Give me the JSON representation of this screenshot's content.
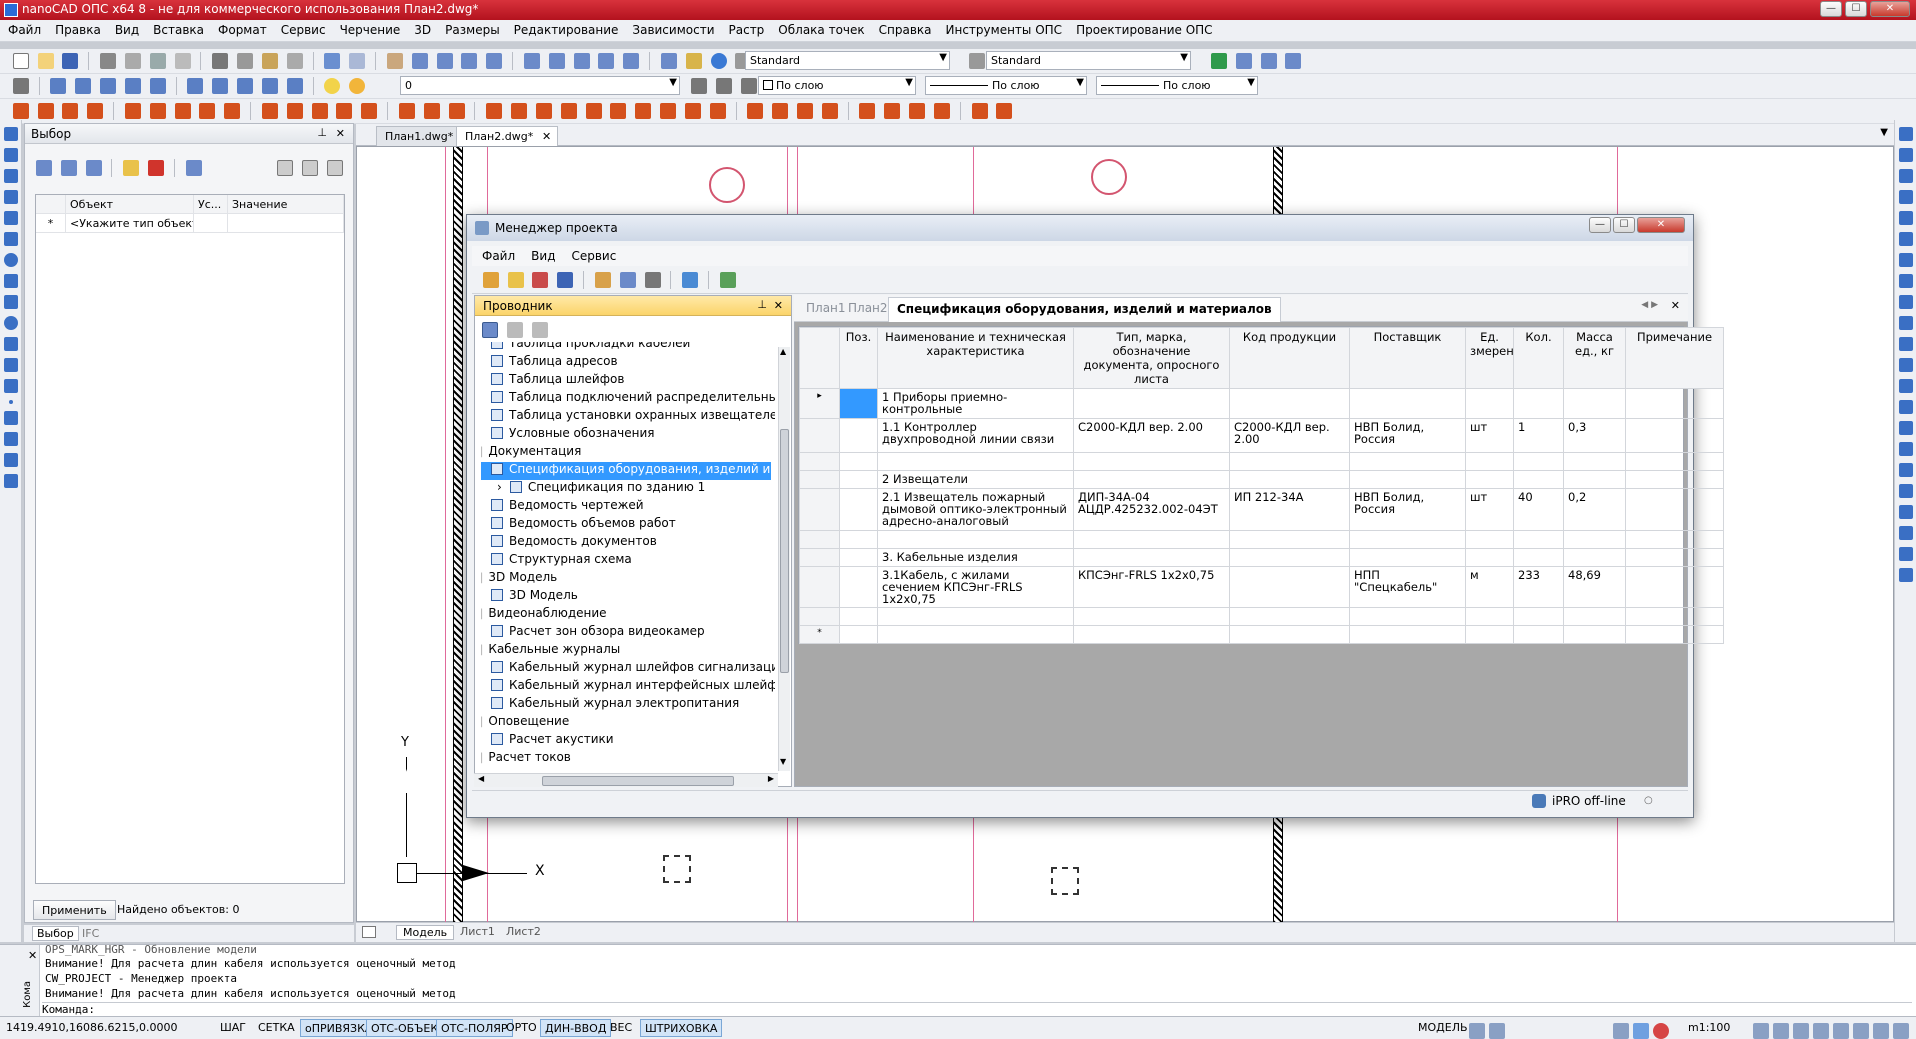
{
  "window": {
    "title": "nanoCAD ОПС х64 8 - не для коммерческого использования План2.dwg*",
    "min": "—",
    "max": "☐",
    "close": "✕"
  },
  "menu": [
    "Файл",
    "Правка",
    "Вид",
    "Вставка",
    "Формат",
    "Сервис",
    "Черчение",
    "3D",
    "Размеры",
    "Редактирование",
    "Зависимости",
    "Растр",
    "Облака точек",
    "Справка",
    "Инструменты ОПС",
    "Проектирование ОПС"
  ],
  "toolbar": {
    "text_style": "Standard",
    "dim_style": "Standard",
    "layer": "0",
    "color": "По слою",
    "linetype": "По слою",
    "lineweight": "По слою"
  },
  "selection_panel": {
    "title": "Выбор",
    "columns": [
      "Объект",
      "Ус...",
      "Значение"
    ],
    "row_marker": "*",
    "row_text": "<Укажите тип объект...",
    "apply_label": "Применить",
    "found_label": "Найдено объектов: 0",
    "tabs": [
      "Выбор",
      "IFC"
    ]
  },
  "doc_tabs": [
    "План1.dwg*",
    "План2.dwg*"
  ],
  "layout_tabs": [
    "Модель",
    "Лист1",
    "Лист2"
  ],
  "axis_labels": {
    "y": "Y",
    "x": "X"
  },
  "dialog": {
    "title": "Менеджер проекта",
    "menu": [
      "Файл",
      "Вид",
      "Сервис"
    ],
    "explorer": {
      "title": "Проводник",
      "items": [
        {
          "label": "Таблица прокладки кабелей",
          "type": "item",
          "indent": 1
        },
        {
          "label": "Таблица адресов",
          "type": "item",
          "indent": 1
        },
        {
          "label": "Таблица шлейфов",
          "type": "item",
          "indent": 1
        },
        {
          "label": "Таблица подключений распределительных коро",
          "type": "item",
          "indent": 1
        },
        {
          "label": "Таблица установки охранных извещателей",
          "type": "item",
          "indent": 1
        },
        {
          "label": "Условные обозначения",
          "type": "item",
          "indent": 1
        },
        {
          "label": "Документация",
          "type": "group",
          "indent": 0
        },
        {
          "label": "Спецификация оборудования, изделий и матери",
          "type": "item",
          "indent": 1,
          "selected": true
        },
        {
          "label": "Спецификация по зданию 1",
          "type": "item",
          "indent": 2,
          "expander": "›"
        },
        {
          "label": "Ведомость чертежей",
          "type": "item",
          "indent": 1
        },
        {
          "label": "Ведомость объемов работ",
          "type": "item",
          "indent": 1
        },
        {
          "label": "Ведомость документов",
          "type": "item",
          "indent": 1
        },
        {
          "label": "Структурная схема",
          "type": "item",
          "indent": 1
        },
        {
          "label": "3D Модель",
          "type": "group",
          "indent": 0
        },
        {
          "label": "3D Модель",
          "type": "item",
          "indent": 1
        },
        {
          "label": "Видеонаблюдение",
          "type": "group",
          "indent": 0
        },
        {
          "label": "Расчет зон обзора видеокамер",
          "type": "item",
          "indent": 1
        },
        {
          "label": "Кабельные журналы",
          "type": "group",
          "indent": 0
        },
        {
          "label": "Кабельный журнал шлейфов сигнализации",
          "type": "item",
          "indent": 1
        },
        {
          "label": "Кабельный журнал интерфейсных шлейфов",
          "type": "item",
          "indent": 1
        },
        {
          "label": "Кабельный журнал электропитания",
          "type": "item",
          "indent": 1
        },
        {
          "label": "Оповещение",
          "type": "group",
          "indent": 0
        },
        {
          "label": "Расчет акустики",
          "type": "item",
          "indent": 1
        },
        {
          "label": "Расчет токов",
          "type": "group",
          "indent": 0
        }
      ]
    },
    "spec_tabs": [
      "План1",
      "План2",
      "Спецификация оборудования, изделий и материалов"
    ],
    "table": {
      "headers": [
        "Поз.",
        "Наименование и техническая характеристика",
        "Тип, марка, обозначение документа, опросного листа",
        "Код продукции",
        "Поставщик",
        "Ед. змерени",
        "Кол.",
        "Масса ед., кг",
        "Примечание"
      ],
      "rows": [
        {
          "marker": "▸",
          "cells": [
            "",
            "1 Приборы приемно-контрольные",
            "",
            "",
            "",
            "",
            "",
            "",
            ""
          ]
        },
        {
          "marker": "",
          "cells": [
            "",
            "1.1 Контроллер двухпроводной линии связи",
            "С2000-КДЛ вер. 2.00",
            "С2000-КДЛ вер. 2.00",
            "НВП Болид, Россия",
            "шт",
            "1",
            "0,3",
            ""
          ]
        },
        {
          "marker": "",
          "cells": [
            "",
            "",
            "",
            "",
            "",
            "",
            "",
            "",
            ""
          ]
        },
        {
          "marker": "",
          "cells": [
            "",
            "2 Извещатели",
            "",
            "",
            "",
            "",
            "",
            "",
            ""
          ]
        },
        {
          "marker": "",
          "cells": [
            "",
            "2.1 Извещатель пожарный дымовой оптико-электронный адресно-аналоговый",
            "ДИП-34А-04 АЦДР.425232.002-04ЭТ",
            "ИП 212-34А",
            "НВП Болид, Россия",
            "шт",
            "40",
            "0,2",
            ""
          ]
        },
        {
          "marker": "",
          "cells": [
            "",
            "",
            "",
            "",
            "",
            "",
            "",
            "",
            ""
          ]
        },
        {
          "marker": "",
          "cells": [
            "",
            "3. Кабельные изделия",
            "",
            "",
            "",
            "",
            "",
            "",
            ""
          ]
        },
        {
          "marker": "",
          "cells": [
            "",
            "3.1Кабель, с жилами сечением КПСЭнг-FRLS 1х2х0,75",
            "КПСЭнг-FRLS 1х2х0,75",
            "",
            "НПП \"Спецкабель\"",
            "м",
            "233",
            "48,69",
            ""
          ]
        },
        {
          "marker": "",
          "cells": [
            "",
            "",
            "",
            "",
            "",
            "",
            "",
            "",
            ""
          ]
        },
        {
          "marker": "*",
          "cells": [
            "",
            "",
            "",
            "",
            "",
            "",
            "",
            "",
            ""
          ]
        }
      ]
    },
    "status": "iPRO off-line"
  },
  "command": {
    "lines": [
      "OPS_MARK_HGR - Обновление модели",
      "Внимание! Для расчета длин кабеля используется оценочный метод",
      "CW_PROJECT - Менеджер проекта",
      "Внимание! Для расчета длин кабеля используется оценочный метод"
    ],
    "prompt": "Команда:",
    "side_label": "Кома"
  },
  "statusbar": {
    "coords": "1419.4910,16086.6215,0.0000",
    "toggles": [
      {
        "label": "ШАГ",
        "on": false
      },
      {
        "label": "СЕТКА",
        "on": false
      },
      {
        "label": "оПРИВЯЗКА",
        "on": true
      },
      {
        "label": "ОТС-ОБЪЕКТ",
        "on": true
      },
      {
        "label": "ОТС-ПОЛЯР",
        "on": true
      },
      {
        "label": "ОРТО",
        "on": false
      },
      {
        "label": "ДИН-ВВОД",
        "on": true
      },
      {
        "label": "ВЕС",
        "on": false
      },
      {
        "label": "ШТРИХОВКА",
        "on": true
      }
    ],
    "model": "МОДЕЛЬ",
    "scale": "m1:100"
  },
  "colors": {
    "accent": "#3399ff",
    "titlebar": "#c4202b",
    "explorer_header": "#fbd46a",
    "drawing_lines": "#e06a9a"
  }
}
